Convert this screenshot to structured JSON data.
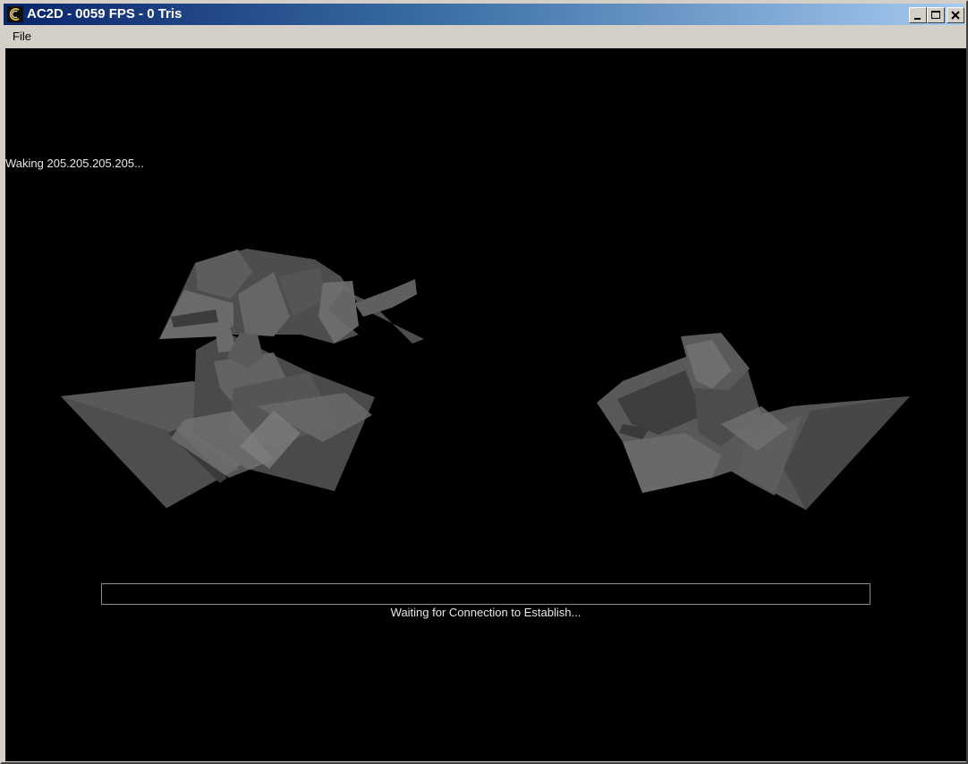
{
  "window": {
    "title": "AC2D - 0059 FPS - 0 Tris",
    "controls": {
      "minimize": "minimize-icon",
      "maximize": "maximize-icon",
      "close": "close-icon"
    }
  },
  "menu": {
    "items": [
      {
        "label": "File"
      }
    ]
  },
  "viewport": {
    "status_text": "Waking 205.205.205.205...",
    "progress": {
      "fraction": 0,
      "label": "Waiting for Connection to Establish..."
    }
  },
  "colors": {
    "title_start": "#0a246a",
    "title_end": "#a6caf0",
    "viewport_bg": "#000000",
    "mesh": "#5a5a5a"
  }
}
